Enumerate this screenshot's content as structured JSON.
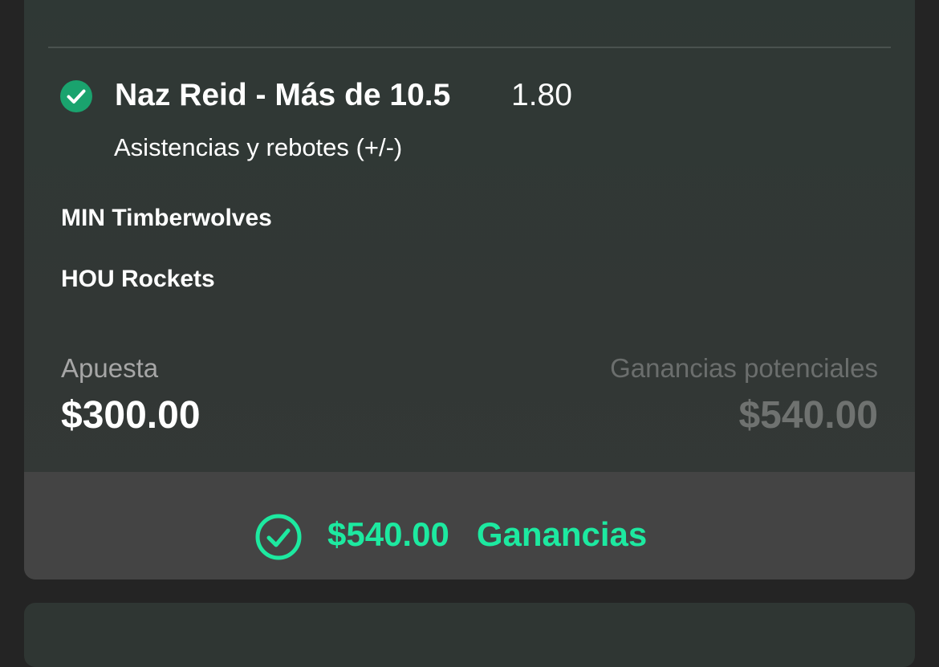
{
  "bet": {
    "selection_title": "Naz Reid - Más de 10.5",
    "odds": "1.80",
    "market": "Asistencias y rebotes (+/-)",
    "teams": [
      "MIN Timberwolves",
      "HOU Rockets"
    ],
    "stake_label": "Apuesta",
    "stake_value": "$300.00",
    "potential_label": "Ganancias potenciales",
    "potential_value": "$540.00"
  },
  "result": {
    "amount": "$540.00",
    "label": "Ganancias"
  },
  "icons": {
    "selection_status": "check-circle-filled-icon",
    "result_status": "check-circle-outline-icon"
  },
  "colors": {
    "win_accent": "#1de9a0",
    "check_fill": "#1aa36e"
  }
}
